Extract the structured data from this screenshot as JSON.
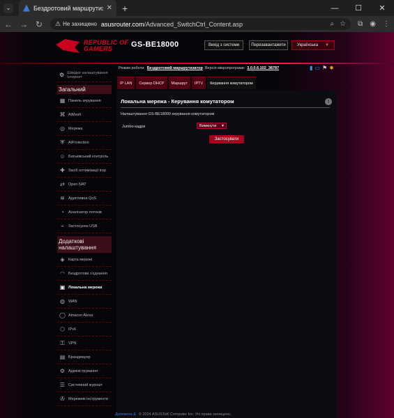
{
  "browser": {
    "tab_title": "Бездротовий маршрутизатор",
    "not_secure": "Не захищено",
    "url_domain": "asusrouter.com",
    "url_path": "/Advanced_SwitchCtrl_Content.asp"
  },
  "header": {
    "brand_line1": "REPUBLIC OF",
    "brand_line2": "GAMERS",
    "model": "GS-BE18000",
    "logout_label": "Вихід з системи",
    "reboot_label": "Перезавантажити",
    "language_label": "Українська"
  },
  "status": {
    "mode_label": "Режим роботи:",
    "mode_value": "Бездротовий маршрутизатор",
    "firmware_label": "Версія мікропрограми:",
    "firmware_value": "3.0.0.6.102_38787"
  },
  "sidebar": {
    "quick": "Швидке налаштування Інтернет",
    "general_title": "Загальний",
    "general_items": [
      {
        "label": "Панель керування",
        "icon": "dashboard-icon"
      },
      {
        "label": "AiMesh",
        "icon": "aimesh-icon"
      },
      {
        "label": "Мережа",
        "icon": "network-icon"
      },
      {
        "label": "AiProtection",
        "icon": "shield-icon"
      },
      {
        "label": "Батьківський контроль",
        "icon": "parental-icon"
      },
      {
        "label": "Засіб оптимізації ігор",
        "icon": "gamepad-icon"
      },
      {
        "label": "Open NAT",
        "icon": "nat-icon"
      },
      {
        "label": "Адаптивна QoS",
        "icon": "qos-icon"
      },
      {
        "label": "Аналізатор потоків",
        "icon": "analyzer-icon"
      },
      {
        "label": "Застосунок USB",
        "icon": "usb-icon"
      }
    ],
    "advanced_title": "Додаткові налаштування",
    "advanced_items": [
      {
        "label": "Карта мережі",
        "icon": "map-icon"
      },
      {
        "label": "Бездротове з'єднання",
        "icon": "wireless-icon"
      },
      {
        "label": "Локальна мережа",
        "icon": "lan-icon",
        "active": true
      },
      {
        "label": "WAN",
        "icon": "wan-icon"
      },
      {
        "label": "Amazon Alexa",
        "icon": "alexa-icon"
      },
      {
        "label": "IPv6",
        "icon": "ipv6-icon"
      },
      {
        "label": "VPN",
        "icon": "vpn-icon"
      },
      {
        "label": "Брандмауер",
        "icon": "firewall-icon"
      },
      {
        "label": "Адміністрування",
        "icon": "admin-icon"
      },
      {
        "label": "Системний журнал",
        "icon": "log-icon"
      },
      {
        "label": "Мережеві інструменти",
        "icon": "tools-icon"
      }
    ]
  },
  "tabs": [
    "IP LAN",
    "Сервер DHCP",
    "Маршрут",
    "IPTV",
    "Керування комутатором"
  ],
  "panel": {
    "title": "Локальна мережа - Керування комутатором",
    "description": "Налаштування GS-BE18000 керування комутатором",
    "jumbo_label": "Jumbo-кадри",
    "jumbo_value": "Вимкнути",
    "apply_label": "Застосувати"
  },
  "footer": {
    "help": "Допомога &",
    "copyright": "© 2024 ASUSTeK Computer Inc. Усі права захищено."
  },
  "colors": {
    "accent": "#c8001e",
    "tab_bg": "#500012",
    "panel_bg": "#0c0c12"
  }
}
